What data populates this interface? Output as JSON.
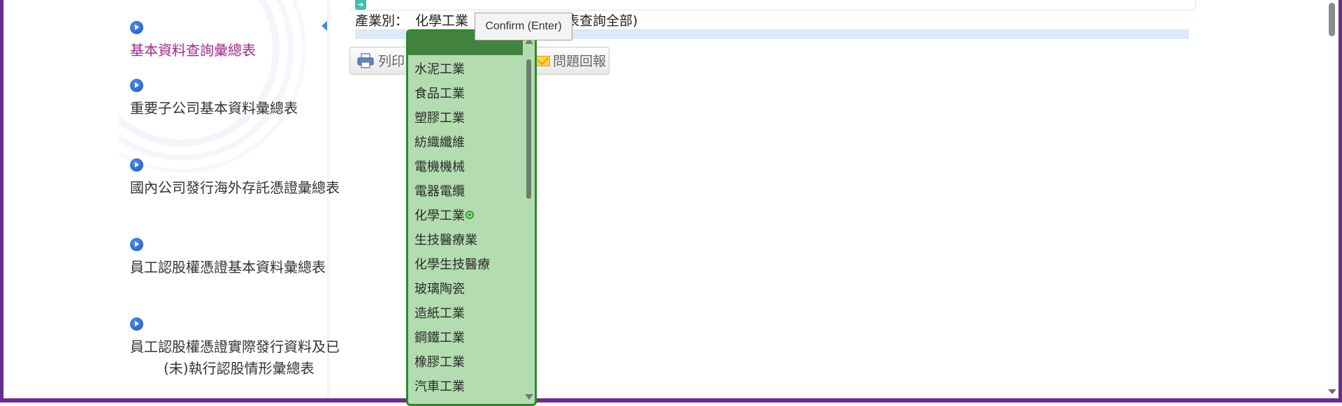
{
  "sidebar": {
    "items": [
      {
        "label": "基本資料查詢彙總表",
        "active": true
      },
      {
        "label": "重要子公司基本資料彙總表"
      },
      {
        "label": "國內公司發行海外存託憑證彙總表"
      },
      {
        "label": "員工認股權憑證基本資料彙總表"
      },
      {
        "label": "員工認股權憑證實際發行資料及已(未)執行認股情形彙總表"
      }
    ]
  },
  "filter": {
    "label": "產業別：",
    "selected": "化學工業",
    "suffix": "表查詢全部)"
  },
  "toolbar": {
    "print_label": "列印",
    "report_label": "問題回報"
  },
  "tooltip": {
    "text": "Confirm (Enter)"
  },
  "dropdown": {
    "options": [
      "水泥工業",
      "食品工業",
      "塑膠工業",
      "紡織纖維",
      "電機機械",
      "電器電纜",
      "化學工業",
      "生技醫療業",
      "化學生技醫療",
      "玻璃陶瓷",
      "造紙工業",
      "鋼鐵工業",
      "橡膠工業",
      "汽車工業"
    ]
  },
  "colors": {
    "frame": "#6a2c8c",
    "active_nav": "#a0288c",
    "dropdown_bg": "#b3ddb0",
    "dropdown_border": "#2c8a2c",
    "dropdown_header": "#41833f"
  }
}
